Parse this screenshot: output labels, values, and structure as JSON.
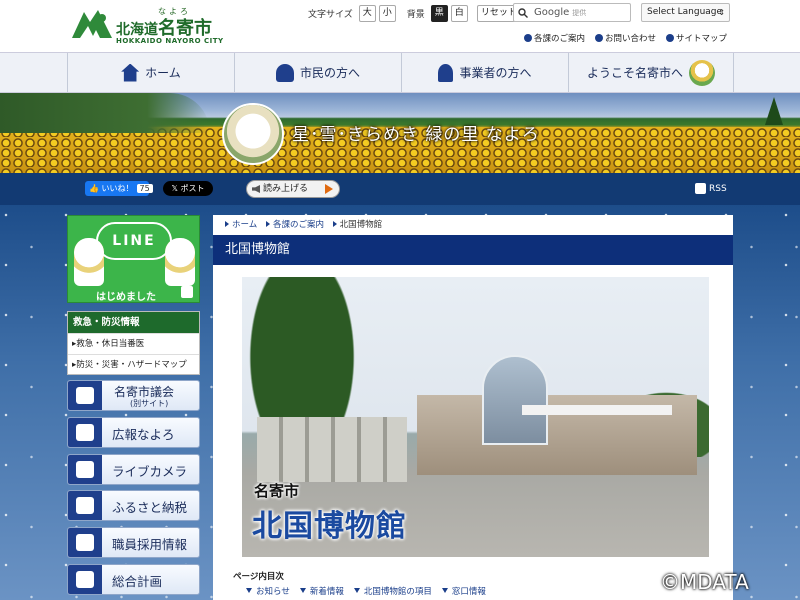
{
  "header": {
    "logo": {
      "kana": "なよろ",
      "prefecture": "北海道",
      "city": "名寄市",
      "en": "HOKKAIDO NAYORO CITY"
    },
    "tools": {
      "font_size_label": "文字サイズ",
      "font_large": "大",
      "font_small": "小",
      "bg_label": "背景",
      "bg_black": "黒",
      "bg_white": "白",
      "reset": "リセット"
    },
    "search": {
      "brand": "Google",
      "placeholder": "提供"
    },
    "language": "Select Language",
    "sublinks": [
      "各課のご案内",
      "お問い合わせ",
      "サイトマップ"
    ]
  },
  "gnav": [
    "ホーム",
    "市民の方へ",
    "事業者の方へ",
    "ようこそ名寄市へ"
  ],
  "banner": {
    "slogan": "星･雪･きらめき 緑の里 なよろ"
  },
  "share": {
    "like_label": "いいね！",
    "like_count": "75",
    "x_label": "ポスト",
    "read_aloud": "読み上げる",
    "rss": "RSS"
  },
  "sidebar": {
    "line": {
      "title": "LINE",
      "note": "はじめました"
    },
    "emergency": {
      "heading": "救急・防災情報",
      "links": [
        "救急・休日当番医",
        "防災・災害・ハザードマップ"
      ]
    },
    "buttons": [
      {
        "label": "名寄市議会",
        "sub": "(別サイト)"
      },
      {
        "label": "広報なよろ"
      },
      {
        "label": "ライブカメラ"
      },
      {
        "label": "ふるさと納税"
      },
      {
        "label": "職員採用情報"
      },
      {
        "label": "総合計画"
      }
    ]
  },
  "content": {
    "breadcrumb": [
      "ホーム",
      "各課のご案内",
      "北国博物館"
    ],
    "title": "北国博物館",
    "photo_caption_small": "名寄市",
    "photo_caption_large": "北国博物館",
    "toc_title": "ページ内目次",
    "toc": [
      "お知らせ",
      "新着情報",
      "北国博物館の項目",
      "窓口情報"
    ]
  },
  "watermark": "©MDATA",
  "colors": {
    "primary": "#0d2f7a",
    "green": "#1e6a2c",
    "line_green": "#3cb54a"
  }
}
